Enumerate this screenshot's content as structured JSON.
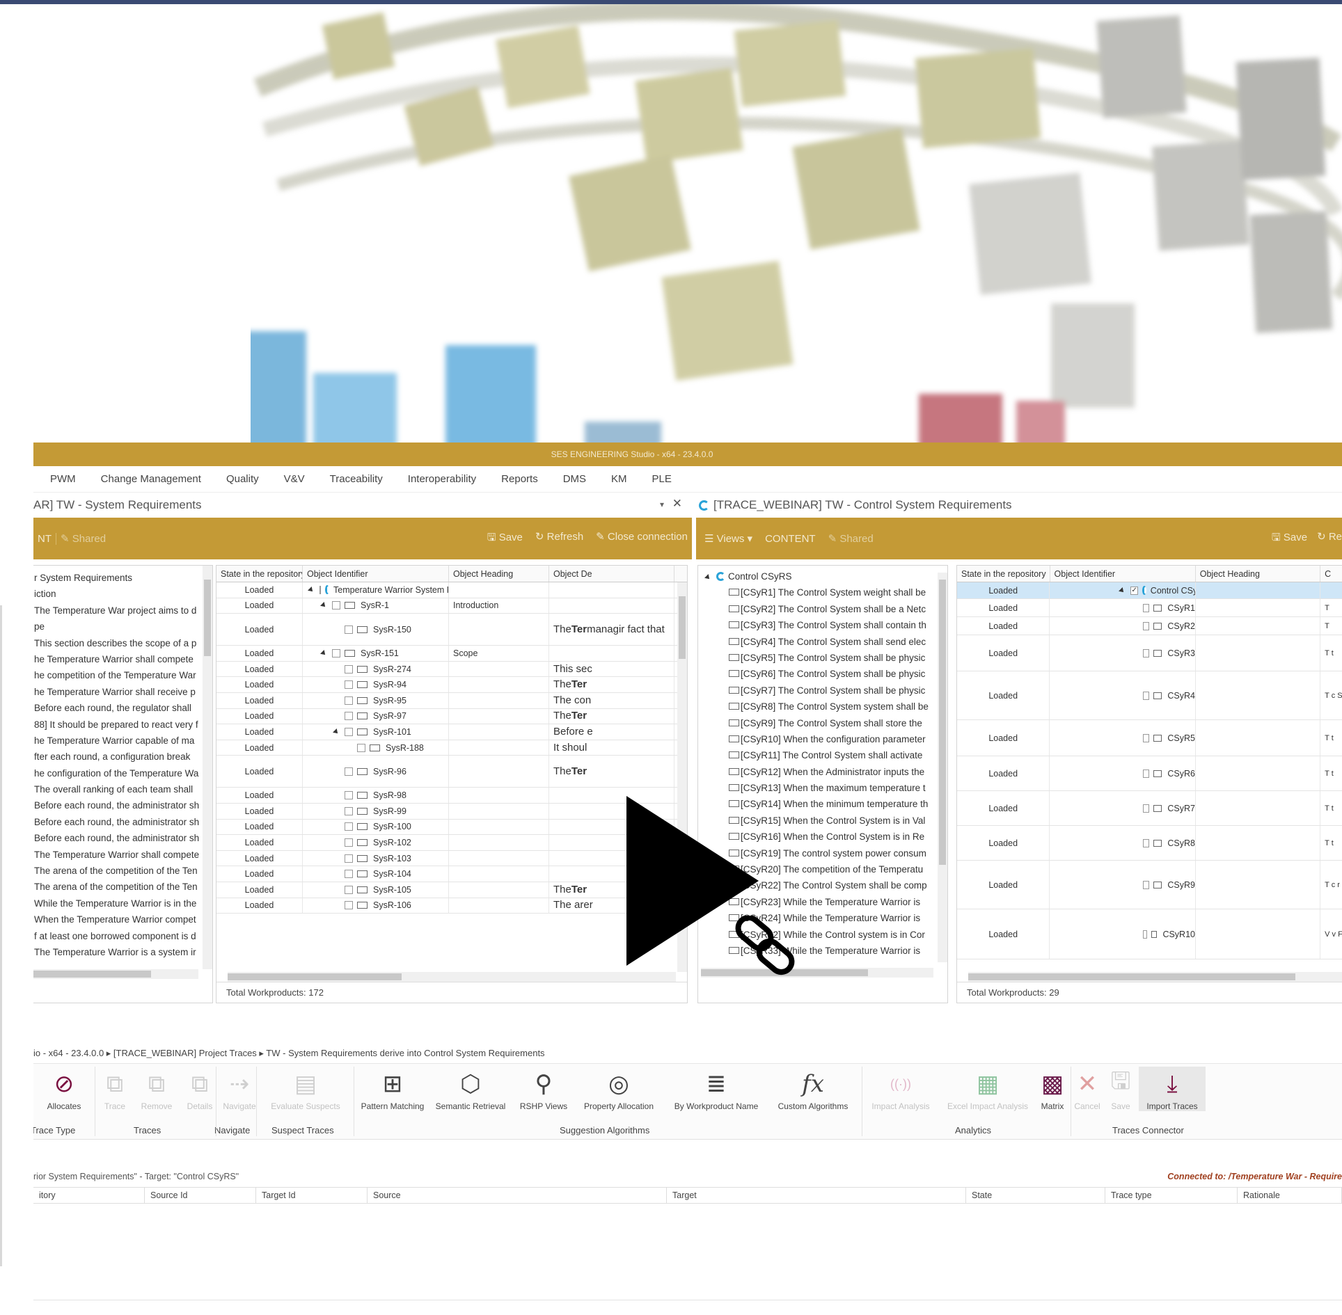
{
  "window": {
    "title": "SES ENGINEERING Studio - x64 - 23.4.0.0"
  },
  "menu": [
    "PWM",
    "Change Management",
    "Quality",
    "V&V",
    "Traceability",
    "Interoperability",
    "Reports",
    "DMS",
    "KM",
    "PLE"
  ],
  "left_tab": {
    "title": "AR] TW - System Requirements",
    "pin": "▾",
    "close": "✕",
    "toolbar_left": "NT",
    "toolbar_shared": "Shared",
    "save": "Save",
    "refresh": "Refresh",
    "close_connection": "Close connection"
  },
  "right_tab": {
    "title": "[TRACE_WEBINAR] TW - Control System Requirements",
    "views": "Views",
    "content": "CONTENT",
    "shared": "Shared",
    "save": "Save",
    "refresh": "Re"
  },
  "left_tree": [
    "r System Requirements",
    "iction",
    "The Temperature War project aims to d",
    "pe",
    "This section describes the scope of a p",
    "he Temperature Warrior shall compete",
    "he competition of the Temperature War",
    "he Temperature Warrior shall receive p",
    "Before each round, the regulator shall",
    "88] It should be prepared to react very f",
    "he Temperature Warrior capable of ma",
    "fter each round, a configuration break",
    "he configuration of the Temperature Wa",
    "The overall ranking of each team shall",
    "Before each round, the administrator sh",
    "Before each round, the administrator sh",
    "Before each round, the administrator sh",
    "The Temperature Warrior shall compete",
    "The arena of the competition of the Ten",
    "The arena of the competition of the Ten",
    "While the Temperature Warrior is in the",
    "When the Temperature Warrior compet",
    "f at least one borrowed component is d",
    "The Temperature Warrior is a system ir"
  ],
  "left_grid": {
    "headers": [
      "State in the repository",
      "Object Identifier",
      "Object Heading",
      "Object De"
    ],
    "rows": [
      {
        "state": "Loaded",
        "id": "Temperature Warrior System F",
        "heading": "",
        "desc": "",
        "lvl": 0,
        "expand": true,
        "type": "root"
      },
      {
        "state": "Loaded",
        "id": "SysR-1",
        "heading": "Introduction",
        "desc": "",
        "lvl": 1,
        "expand": true,
        "type": "doc"
      },
      {
        "state": "Loaded",
        "id": "SysR-150",
        "heading": "",
        "desc": "The Ter managir fact that",
        "lvl": 2,
        "expand": false,
        "type": "doc",
        "tall": true
      },
      {
        "state": "Loaded",
        "id": "SysR-151",
        "heading": "Scope",
        "desc": "",
        "lvl": 1,
        "expand": true,
        "type": "doc"
      },
      {
        "state": "Loaded",
        "id": "SysR-274",
        "heading": "",
        "desc": "This sec",
        "lvl": 2,
        "type": "doc"
      },
      {
        "state": "Loaded",
        "id": "SysR-94",
        "heading": "",
        "desc": "The Ter",
        "lvl": 2,
        "type": "doc"
      },
      {
        "state": "Loaded",
        "id": "SysR-95",
        "heading": "",
        "desc": "The con",
        "lvl": 2,
        "type": "doc"
      },
      {
        "state": "Loaded",
        "id": "SysR-97",
        "heading": "",
        "desc": "The Ter",
        "lvl": 2,
        "type": "doc"
      },
      {
        "state": "Loaded",
        "id": "SysR-101",
        "heading": "",
        "desc": "Before e",
        "lvl": 2,
        "expand": true,
        "type": "doc"
      },
      {
        "state": "Loaded",
        "id": "SysR-188",
        "heading": "",
        "desc": "It shoul",
        "lvl": 3,
        "type": "doc"
      },
      {
        "state": "Loaded",
        "id": "SysR-96",
        "heading": "",
        "desc": "The Ter",
        "lvl": 2,
        "type": "doc",
        "tall": true
      },
      {
        "state": "Loaded",
        "id": "SysR-98",
        "heading": "",
        "desc": "",
        "lvl": 2,
        "type": "doc"
      },
      {
        "state": "Loaded",
        "id": "SysR-99",
        "heading": "",
        "desc": "",
        "lvl": 2,
        "type": "doc"
      },
      {
        "state": "Loaded",
        "id": "SysR-100",
        "heading": "",
        "desc": "",
        "lvl": 2,
        "type": "doc"
      },
      {
        "state": "Loaded",
        "id": "SysR-102",
        "heading": "",
        "desc": "",
        "lvl": 2,
        "type": "doc"
      },
      {
        "state": "Loaded",
        "id": "SysR-103",
        "heading": "",
        "desc": "",
        "lvl": 2,
        "type": "doc"
      },
      {
        "state": "Loaded",
        "id": "SysR-104",
        "heading": "",
        "desc": "",
        "lvl": 2,
        "type": "doc"
      },
      {
        "state": "Loaded",
        "id": "SysR-105",
        "heading": "",
        "desc": "The Ter",
        "lvl": 2,
        "type": "doc"
      },
      {
        "state": "Loaded",
        "id": "SysR-106",
        "heading": "",
        "desc": "The arer",
        "lvl": 2,
        "type": "doc"
      }
    ],
    "total": "Total Workproducts: 172"
  },
  "right_tree": {
    "root": "Control CSyRS",
    "items": [
      "[CSyR1] The Control System weight shall be",
      "[CSyR2] The Control System shall be a Netc",
      "[CSyR3] The Control System shall contain th",
      "[CSyR4] The Control System shall send elec",
      "[CSyR5] The Control System shall be physic",
      "[CSyR6] The Control System shall be physic",
      "[CSyR7] The Control System shall be physic",
      "[CSyR8] The Control System system shall be",
      "[CSyR9] The Control System shall store the",
      "[CSyR10] When the configuration parameter",
      "[CSyR11] The Control System shall activate",
      "[CSyR12] When the Administrator inputs the",
      "[CSyR13] When the maximum temperature t",
      "[CSyR14] When the minimum temperature th",
      "[CSyR15] When the Control System is in Val",
      "[CSyR16] When the Control System is in Re",
      "[CSyR19] The control system power consum",
      "[CSyR20] The competition of the Temperatu",
      "[CSyR22] The Control System shall be comp",
      "[CSyR23] While the Temperature Warrior is",
      "[CSyR24] While the Temperature Warrior is",
      "[CSyR32] While the Control system is in Cor",
      "[CSyR33] While the Temperature Warrior is"
    ]
  },
  "right_grid": {
    "headers": [
      "State in the repository",
      "Object Identifier",
      "Object Heading",
      "C"
    ],
    "rows": [
      {
        "state": "Loaded",
        "id": "Control CSyRS",
        "root": true,
        "h": 24,
        "mark": ""
      },
      {
        "state": "Loaded",
        "id": "CSyR1",
        "h": 26,
        "mark": "T"
      },
      {
        "state": "Loaded",
        "id": "CSyR2",
        "h": 26,
        "mark": "T"
      },
      {
        "state": "Loaded",
        "id": "CSyR3",
        "h": 52,
        "mark": "T t"
      },
      {
        "state": "Loaded",
        "id": "CSyR4",
        "h": 70,
        "mark": "T c S"
      },
      {
        "state": "Loaded",
        "id": "CSyR5",
        "h": 52,
        "mark": "T t"
      },
      {
        "state": "Loaded",
        "id": "CSyR6",
        "h": 50,
        "mark": "T t"
      },
      {
        "state": "Loaded",
        "id": "CSyR7",
        "h": 50,
        "mark": "T t"
      },
      {
        "state": "Loaded",
        "id": "CSyR8",
        "h": 50,
        "mark": "T t"
      },
      {
        "state": "Loaded",
        "id": "CSyR9",
        "h": 70,
        "mark": "T c r"
      },
      {
        "state": "Loaded",
        "id": "CSyR10",
        "h": 72,
        "mark": "V v F"
      }
    ],
    "total": "Total Workproducts: 29"
  },
  "breadcrumb": "io - x64 - 23.4.0.0  ▸  [TRACE_WEBINAR] Project Traces  ▸  TW - System Requirements derive into Control System Requirements",
  "ribbon": {
    "buttons": [
      {
        "label": "Allocates",
        "disabled": false
      },
      {
        "label": "Trace",
        "disabled": true
      },
      {
        "label": "Remove",
        "disabled": true
      },
      {
        "label": "Details",
        "disabled": true
      },
      {
        "label": "Navigate",
        "disabled": true
      },
      {
        "label": "Evaluate Suspects",
        "disabled": true
      },
      {
        "label": "Pattern Matching",
        "disabled": false
      },
      {
        "label": "Semantic Retrieval",
        "disabled": false
      },
      {
        "label": "RSHP Views",
        "disabled": false
      },
      {
        "label": "Property Allocation",
        "disabled": false
      },
      {
        "label": "By Workproduct Name",
        "disabled": false
      },
      {
        "label": "Custom Algorithms",
        "disabled": false
      },
      {
        "label": "Impact Analysis",
        "disabled": true
      },
      {
        "label": "Excel Impact Analysis",
        "disabled": true
      },
      {
        "label": "Matrix",
        "disabled": false
      },
      {
        "label": "Cancel",
        "disabled": true
      },
      {
        "label": "Save",
        "disabled": true
      },
      {
        "label": "Import Traces",
        "disabled": false
      }
    ],
    "groups": [
      "Trace Type",
      "Traces",
      "Navigate",
      "Suspect Traces",
      "Suggestion Algorithms",
      "Analytics",
      "Traces Connector"
    ],
    "fx": "fx"
  },
  "traces": {
    "info": "rior System Requirements\" - Target: \"Control CSyRS\"",
    "connected": "Connected to: /Temperature War - Require",
    "headers": [
      "itory",
      "Source Id",
      "Target Id",
      "Source",
      "Target",
      "State",
      "Trace type",
      "Rationale"
    ]
  },
  "colors": {
    "gold": "#c49a36",
    "navy": "#3a4a73",
    "accent_blue": "#2aa3d8"
  }
}
